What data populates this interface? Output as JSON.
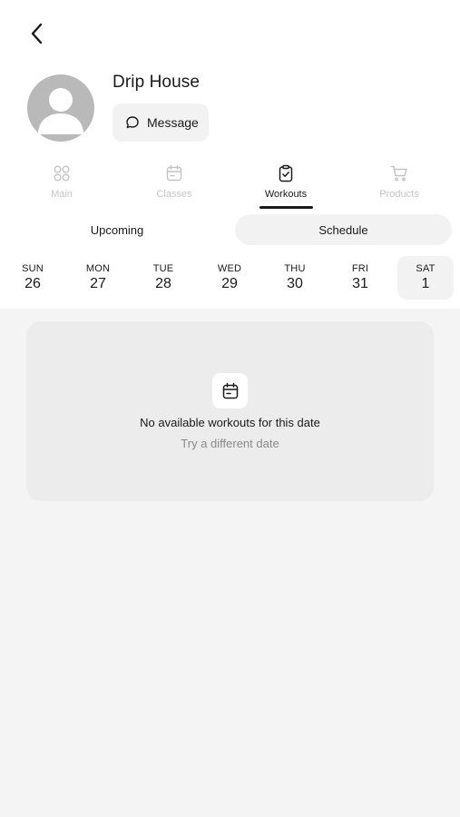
{
  "profile": {
    "name": "Drip House",
    "message_label": "Message"
  },
  "tabs": [
    {
      "label": "Main",
      "icon": "grid-icon",
      "active": false
    },
    {
      "label": "Classes",
      "icon": "calendar-icon",
      "active": false
    },
    {
      "label": "Workouts",
      "icon": "clipboard-check-icon",
      "active": true
    },
    {
      "label": "Products",
      "icon": "cart-icon",
      "active": false
    }
  ],
  "segment": {
    "upcoming": "Upcoming",
    "schedule": "Schedule",
    "selected": "Schedule"
  },
  "days": [
    {
      "name": "SUN",
      "date": "26"
    },
    {
      "name": "MON",
      "date": "27"
    },
    {
      "name": "TUE",
      "date": "28"
    },
    {
      "name": "WED",
      "date": "29"
    },
    {
      "name": "THU",
      "date": "30"
    },
    {
      "name": "FRI",
      "date": "31"
    },
    {
      "name": "SAT",
      "date": "1"
    }
  ],
  "selected_day": "SAT",
  "empty_state": {
    "title": "No available workouts for this date",
    "subtitle": "Try a different date",
    "icon": "calendar-icon"
  },
  "colors": {
    "active": "#1a1a1a",
    "inactive": "#c4c4c4",
    "background": "#f4f4f4"
  }
}
